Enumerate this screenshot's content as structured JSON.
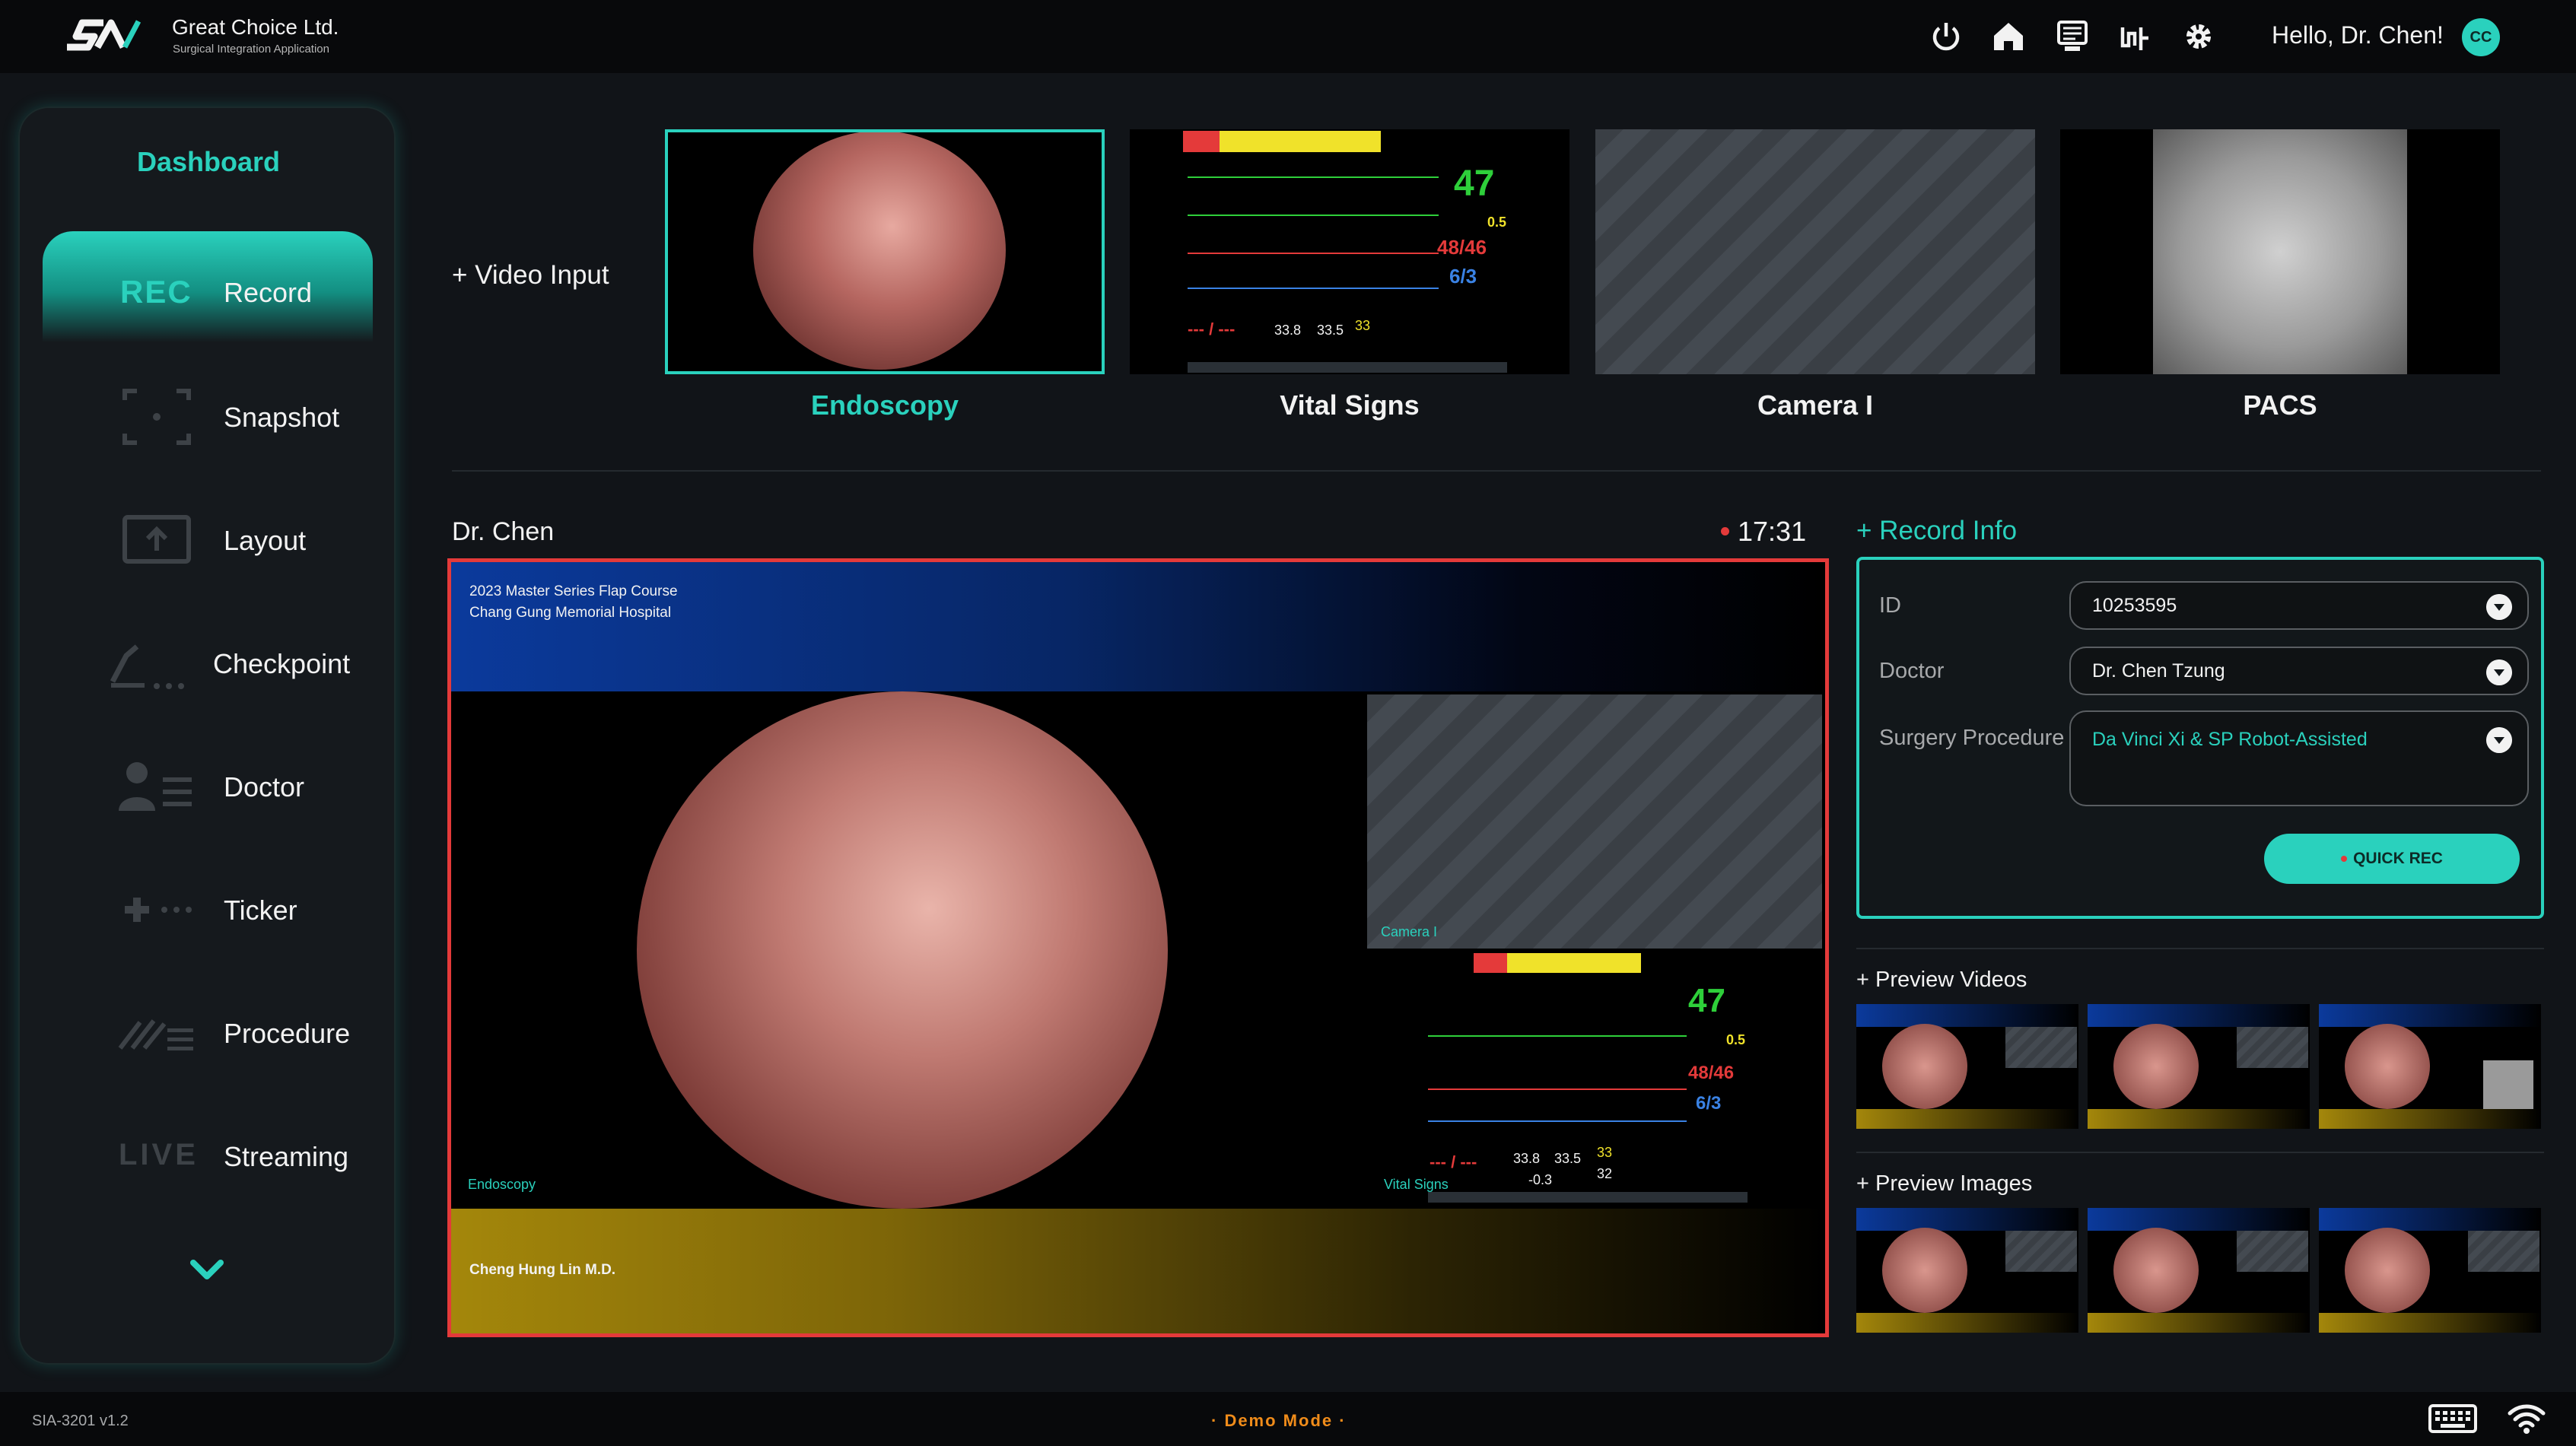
{
  "header": {
    "company": "Great Choice Ltd.",
    "subtitle": "Surgical Integration Application",
    "greeting": "Hello, Dr. Chen!",
    "avatar_initials": "CC",
    "icons": [
      "power-icon",
      "home-icon",
      "monitor-icon",
      "pointer-icon",
      "gear-icon"
    ]
  },
  "sidebar": {
    "title": "Dashboard",
    "rec_mark": "REC",
    "items": [
      {
        "label": "Record",
        "icon": "rec-icon"
      },
      {
        "label": "Snapshot",
        "icon": "snapshot-icon"
      },
      {
        "label": "Layout",
        "icon": "layout-icon"
      },
      {
        "label": "Checkpoint",
        "icon": "checkpoint-icon"
      },
      {
        "label": "Doctor",
        "icon": "doctor-icon"
      },
      {
        "label": "Ticker",
        "icon": "ticker-icon"
      },
      {
        "label": "Procedure",
        "icon": "procedure-icon"
      },
      {
        "label": "Streaming",
        "icon": "live-icon",
        "mark": "LIVE"
      }
    ]
  },
  "sources": {
    "add_label": "+ Video Input",
    "items": [
      {
        "label": "Endoscopy"
      },
      {
        "label": "Vital Signs"
      },
      {
        "label": "Camera I"
      },
      {
        "label": "PACS"
      }
    ]
  },
  "main": {
    "doctor_name": "Dr. Chen",
    "rec_time": "17:31",
    "banner_line1": "2023 Master Series Flap Course",
    "banner_line2": "Chang Gung Memorial Hospital",
    "label_endoscopy": "Endoscopy",
    "label_camera": "Camera I",
    "label_vitals": "Vital Signs",
    "footer_name": "Cheng Hung Lin M.D."
  },
  "vitals": {
    "hr": "47",
    "bp": "48/46",
    "small_a": "0.5",
    "small_b": "6/3",
    "t1": "33.8",
    "t2": "33.5",
    "t3": "-0.3",
    "t4": "33",
    "t5": "32",
    "dash": "--- / ---"
  },
  "record_info": {
    "title": "+ Record Info",
    "id_label": "ID",
    "id_value": "10253595",
    "doctor_label": "Doctor",
    "doctor_value": "Dr. Chen Tzung",
    "procedure_label": "Surgery Procedure",
    "procedure_value": "Da Vinci Xi & SP Robot-Assisted",
    "quick_rec": "QUICK REC"
  },
  "previews": {
    "videos_title": "+ Preview Videos",
    "images_title": "+ Preview Images"
  },
  "footer": {
    "version": "SIA-3201 v1.2",
    "mode": "· Demo Mode ·"
  },
  "colors": {
    "accent": "#2ad1bd",
    "record_red": "#e43a3a",
    "demo_orange": "#f08c1a",
    "background": "#111418"
  }
}
